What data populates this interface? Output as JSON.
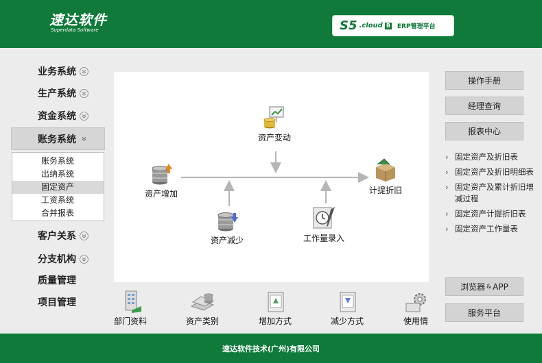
{
  "header": {
    "logo_cn": "速达软件",
    "logo_en": "Superdata Software",
    "product_s5": "S5",
    "product_cloud": ".cloud",
    "product_badge": "B",
    "product_erp": "ERP管理平台"
  },
  "nav": {
    "items_top": [
      "业务系统",
      "生产系统",
      "资金系统"
    ],
    "active": "账务系统",
    "submenu": [
      "账务系统",
      "出纳系统",
      "固定资产",
      "工资系统",
      "合并报表"
    ],
    "submenu_selected": "固定资产",
    "items_bottom_chev": [
      "客户关系",
      "分支机构"
    ],
    "items_bottom_plain": [
      "质量管理",
      "项目管理"
    ]
  },
  "flow": {
    "asset_add": "资产增加",
    "asset_change": "资产变动",
    "asset_reduce": "资产减少",
    "workload_entry": "工作量录入",
    "depreciation": "计提折旧"
  },
  "bottom": {
    "dept": "部门资料",
    "category": "资产类别",
    "add_method": "增加方式",
    "reduce_method": "减少方式",
    "usage": "使用情"
  },
  "right": {
    "manual": "操作手册",
    "manager_query": "经理查询",
    "report_center": "报表中心",
    "reports": [
      "固定资产及折旧表",
      "固定资产及折旧明细表",
      "固定资产及累计折旧增减过程",
      "固定资产计提折旧表",
      "固定资产工作量表"
    ],
    "browser_a": "浏览器",
    "browser_amp": "&",
    "browser_b": "APP",
    "service": "服务平台"
  },
  "footer": {
    "company": "速达软件技术(广州)有限公司"
  },
  "colors": {
    "brand_green": "#0f7a3a",
    "arrow_gray": "#b5b5b5"
  }
}
